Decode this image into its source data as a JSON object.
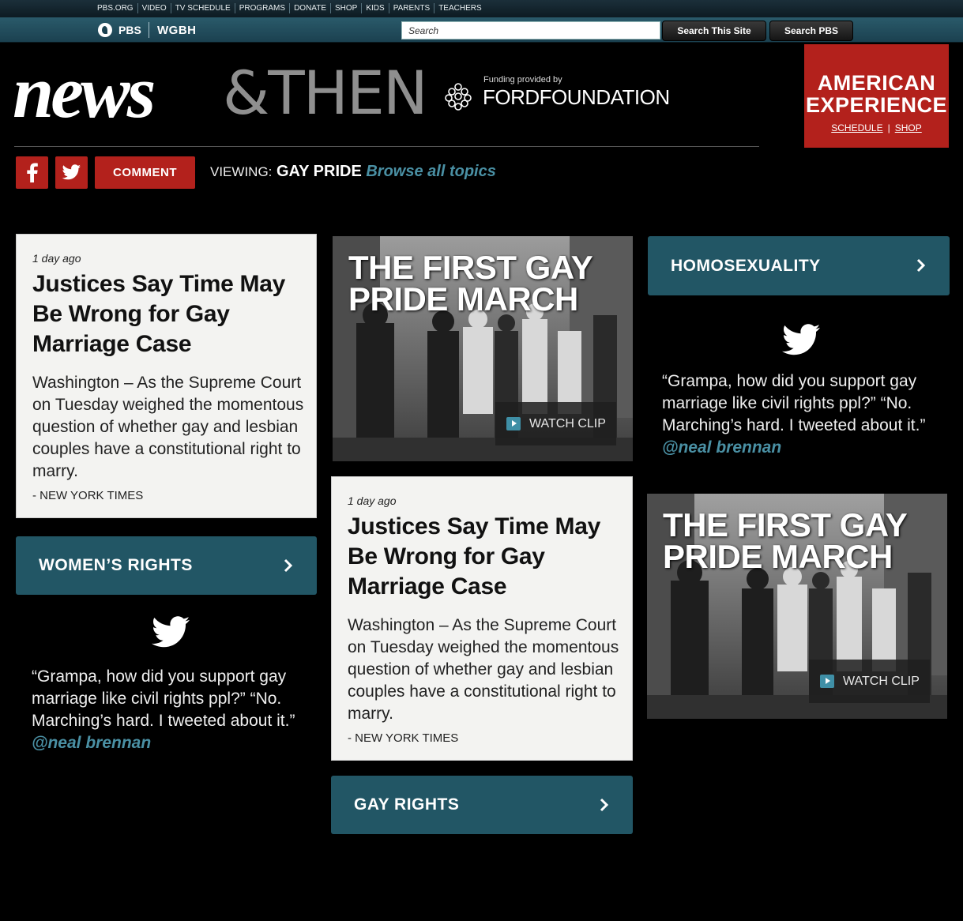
{
  "pbs_nav": {
    "links": [
      "PBS.ORG",
      "VIDEO",
      "TV SCHEDULE",
      "PROGRAMS",
      "DONATE",
      "SHOP",
      "KIDS",
      "PARENTS",
      "TEACHERS"
    ],
    "pbs_label": "PBS",
    "station": "WGBH",
    "search_placeholder": "Search",
    "search_site_label": "Search This Site",
    "search_pbs_label": "Search PBS"
  },
  "masthead": {
    "logo_news": "news",
    "logo_then": "&THEN",
    "funding_label": "Funding provided by",
    "funder": "FORDFOUNDATION"
  },
  "amex": {
    "title_line1": "AMERICAN",
    "title_line2": "EXPERIENCE",
    "schedule": "SCHEDULE",
    "separator": "|",
    "shop": "SHOP"
  },
  "share": {
    "comment": "COMMENT",
    "viewing_label": "VIEWING:",
    "topic": "GAY PRIDE",
    "browse": "Browse all topics"
  },
  "articles": [
    {
      "ago": "1 day ago",
      "headline": "Justices Say Time May Be Wrong for Gay Marriage Case",
      "body": "Washington – As the Supreme Court on Tuesday weighed the momentous question of whether gay and lesbian couples have a constitutional right to marry.",
      "source": "- NEW YORK TIMES"
    },
    {
      "ago": "1 day ago",
      "headline": "Justices Say Time May Be Wrong for Gay Marriage Case",
      "body": "Washington – As the Supreme Court on Tuesday weighed the momentous question of whether gay and lesbian couples have a constitutional right to marry.",
      "source": "- NEW YORK TIMES"
    }
  ],
  "videos": [
    {
      "title": "THE FIRST GAY PRIDE MARCH",
      "watch": "WATCH CLIP"
    },
    {
      "title": "THE FIRST GAY PRIDE MARCH",
      "watch": "WATCH CLIP"
    }
  ],
  "topics": [
    {
      "label": "HOMOSEXUALITY"
    },
    {
      "label": "WOMEN’S RIGHTS"
    },
    {
      "label": "GAY RIGHTS"
    }
  ],
  "tweets": [
    {
      "text": "“Grampa, how did you support gay marriage like civil rights ppl?” “No. Marching’s hard. I tweeted about it.”",
      "handle": "@neal brennan"
    },
    {
      "text": "“Grampa, how did you support gay marriage like civil rights ppl?” “No. Marching’s hard. I tweeted about it.”",
      "handle": "@neal brennan"
    }
  ],
  "colors": {
    "accent_red": "#b3211c",
    "topic_teal": "#225665",
    "link_blue": "#4a90a4"
  }
}
